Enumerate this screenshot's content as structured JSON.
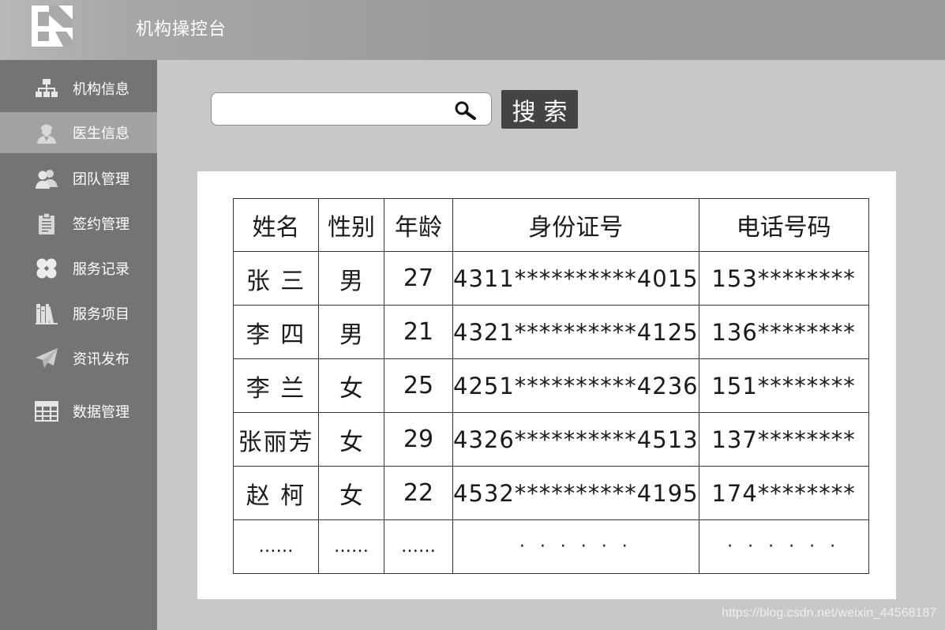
{
  "app": {
    "title": "机构操控台"
  },
  "sidebar": {
    "items": [
      {
        "label": "机构信息",
        "icon": "org-chart-icon",
        "active": false
      },
      {
        "label": "医生信息",
        "icon": "doctor-icon",
        "active": true
      },
      {
        "label": "团队管理",
        "icon": "team-icon",
        "active": false
      },
      {
        "label": "签约管理",
        "icon": "clipboard-icon",
        "active": false
      },
      {
        "label": "服务记录",
        "icon": "clover-icon",
        "active": false
      },
      {
        "label": "服务项目",
        "icon": "books-icon",
        "active": false
      },
      {
        "label": "资讯发布",
        "icon": "paper-plane-icon",
        "active": false
      },
      {
        "label": "数据管理",
        "icon": "grid-table-icon",
        "active": false
      }
    ]
  },
  "search": {
    "value": "",
    "placeholder": "",
    "button_label": "搜索"
  },
  "table": {
    "headers": [
      "姓名",
      "性别",
      "年龄",
      "身份证号",
      "电话号码"
    ],
    "rows": [
      [
        "张 三",
        "男",
        "27",
        "4311**********4015",
        "153********"
      ],
      [
        "李 四",
        "男",
        "21",
        "4321**********4125",
        "136********"
      ],
      [
        "李 兰",
        "女",
        "25",
        "4251**********4236",
        "151********"
      ],
      [
        "张丽芳",
        "女",
        "29",
        "4326**********4513",
        "137********"
      ],
      [
        "赵 柯",
        "女",
        "22",
        "4532**********4195",
        "174********"
      ],
      [
        "……",
        "……",
        "……",
        "· · · · · ·",
        "· · · · · ·"
      ]
    ]
  },
  "watermark": "https://blog.csdn.net/weixin_44568187",
  "colors": {
    "header": "#9b9b9b",
    "sidebar": "#747474",
    "sidebar_active": "#a2a2a2",
    "content_bg": "#c8c8c8",
    "search_button": "#444444"
  }
}
